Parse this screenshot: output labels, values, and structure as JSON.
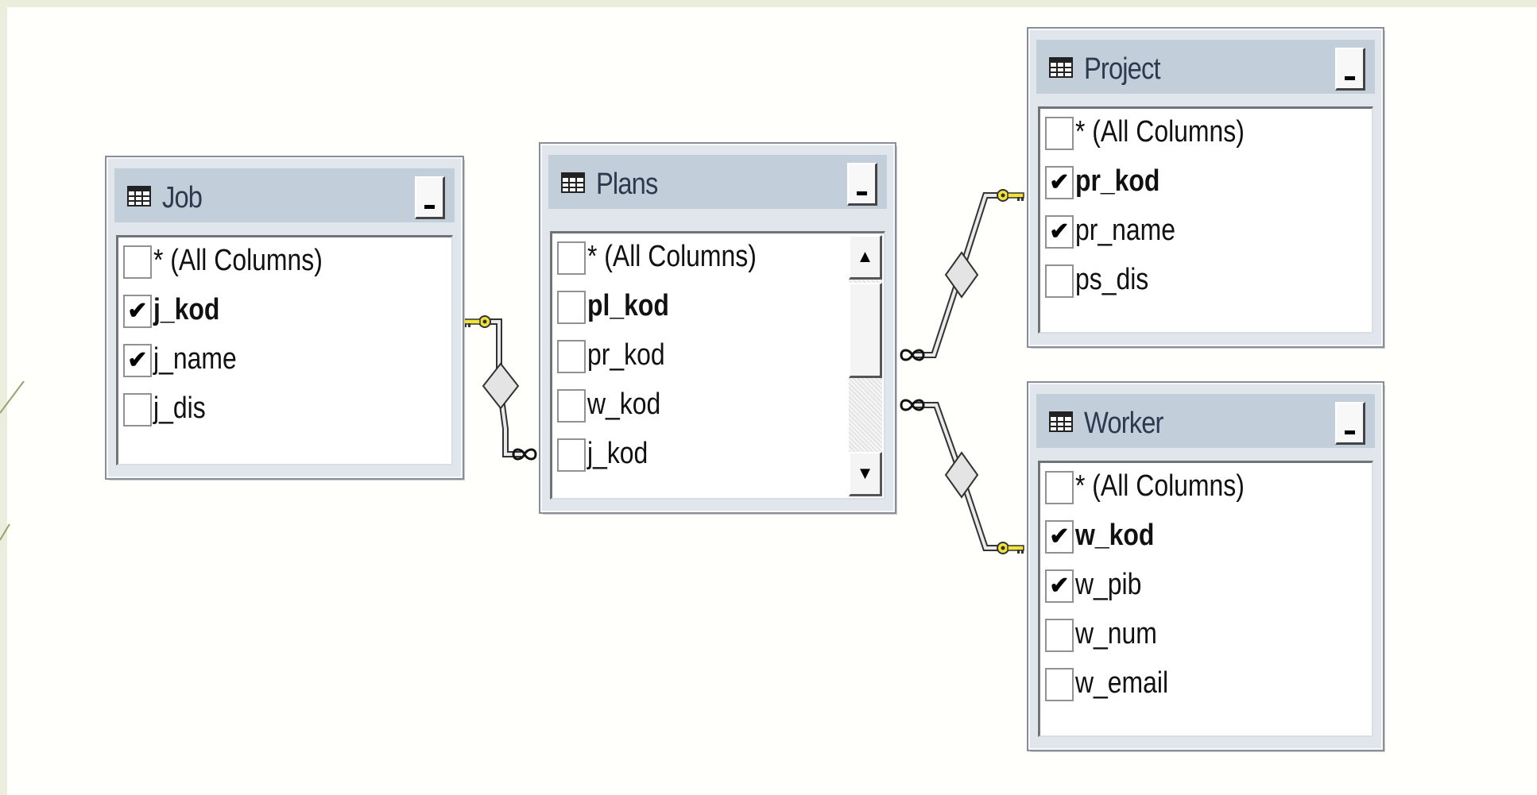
{
  "tables": {
    "job": {
      "title": "Job",
      "columns": [
        {
          "name": "* (All Columns)",
          "checked": false,
          "key": false,
          "mark": ""
        },
        {
          "name": "j_kod",
          "checked": true,
          "key": true,
          "mark": "✔"
        },
        {
          "name": "j_name",
          "checked": true,
          "key": false,
          "mark": "✔"
        },
        {
          "name": "j_dis",
          "checked": false,
          "key": false,
          "mark": ""
        }
      ]
    },
    "plans": {
      "title": "Plans",
      "columns": [
        {
          "name": "* (All Columns)",
          "checked": false,
          "key": false,
          "mark": ""
        },
        {
          "name": "pl_kod",
          "checked": false,
          "key": true,
          "mark": ""
        },
        {
          "name": "pr_kod",
          "checked": false,
          "key": false,
          "mark": ""
        },
        {
          "name": "w_kod",
          "checked": false,
          "key": false,
          "mark": ""
        },
        {
          "name": "j_kod",
          "checked": false,
          "key": false,
          "mark": ""
        }
      ],
      "scroll_up_glyph": "▲",
      "scroll_down_glyph": "▼"
    },
    "project": {
      "title": "Project",
      "columns": [
        {
          "name": "* (All Columns)",
          "checked": false,
          "key": false,
          "mark": ""
        },
        {
          "name": "pr_kod",
          "checked": true,
          "key": true,
          "mark": "✔"
        },
        {
          "name": "pr_name",
          "checked": true,
          "key": false,
          "mark": "✔"
        },
        {
          "name": "ps_dis",
          "checked": false,
          "key": false,
          "mark": ""
        }
      ]
    },
    "worker": {
      "title": "Worker",
      "columns": [
        {
          "name": "* (All Columns)",
          "checked": false,
          "key": false,
          "mark": ""
        },
        {
          "name": "w_kod",
          "checked": true,
          "key": true,
          "mark": "✔"
        },
        {
          "name": "w_pib",
          "checked": true,
          "key": false,
          "mark": "✔"
        },
        {
          "name": "w_num",
          "checked": false,
          "key": false,
          "mark": ""
        },
        {
          "name": "w_email",
          "checked": false,
          "key": false,
          "mark": ""
        }
      ]
    }
  },
  "relationships": [
    {
      "from": "job.j_kod",
      "to": "plans.j_kod",
      "one_end": "key-icon",
      "many_end": "infinity-icon"
    },
    {
      "from": "project.pr_kod",
      "to": "plans.pr_kod",
      "one_end": "key-icon",
      "many_end": "infinity-icon"
    },
    {
      "from": "worker.w_kod",
      "to": "plans.w_kod",
      "one_end": "key-icon",
      "many_end": "infinity-icon"
    }
  ],
  "colors": {
    "title_bar": "#c3cedb",
    "window": "#e1e6ec",
    "key_icon": "#f2e23a",
    "link_line": "#e8e8e8"
  }
}
